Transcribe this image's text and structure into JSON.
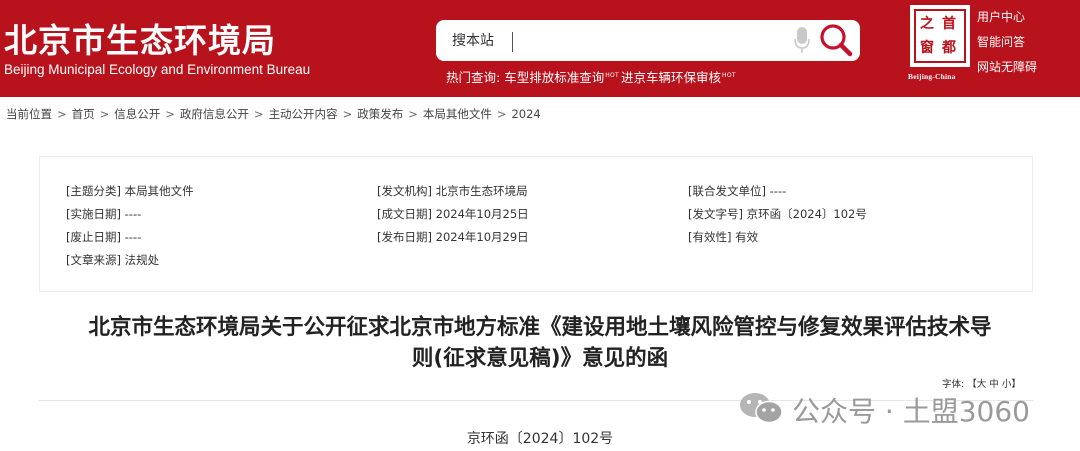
{
  "header": {
    "logo_cn": "北京市生态环境局",
    "logo_en": "Beijing Municipal Ecology and Environment Bureau",
    "search": {
      "placeholder": "搜本站",
      "value": ""
    },
    "hot_search": {
      "label": "热门查询:",
      "links": [
        "车型排放标准查询",
        "进京车辆环保审核"
      ],
      "hot_badge": "HOT"
    },
    "seal": {
      "chars": [
        "首",
        "都",
        "之",
        "窗"
      ],
      "subtitle": "Beijing-China"
    },
    "user_links": [
      "用户中心",
      "智能问答",
      "网站无障碍"
    ]
  },
  "breadcrumb": [
    "当前位置",
    "首页",
    "信息公开",
    "政府信息公开",
    "主动公开内容",
    "政策发布",
    "本局其他文件",
    "2024"
  ],
  "breadcrumb_sep": ">",
  "info": [
    {
      "label": "[主题分类]",
      "value": "本局其他文件"
    },
    {
      "label": "[发文机构]",
      "value": "北京市生态环境局"
    },
    {
      "label": "[联合发文单位]",
      "value": "----"
    },
    {
      "label": "[实施日期]",
      "value": "----"
    },
    {
      "label": "[成文日期]",
      "value": "2024年10月25日"
    },
    {
      "label": "[发文字号]",
      "value": "京环函〔2024〕102号"
    },
    {
      "label": "[废止日期]",
      "value": "----"
    },
    {
      "label": "[发布日期]",
      "value": "2024年10月29日"
    },
    {
      "label": "[有效性]",
      "value": "有效"
    },
    {
      "label": "[文章来源]",
      "value": "法规处"
    }
  ],
  "title_line1": "北京市生态环境局关于公开征求北京市地方标准《建设用地土壤风险管控与修复效果评估技术导",
  "title_line2": "则(征求意见稿)》意见的函",
  "font_size": {
    "label": "字体:",
    "open": "【",
    "options": [
      "大",
      "中",
      "小"
    ],
    "close": "】"
  },
  "doc_number": "京环函〔2024〕102号",
  "watermark": "公众号 · 土盟3060",
  "colors": {
    "brand_red": "#b8121d",
    "hot_yellow": "#ffd84a"
  }
}
